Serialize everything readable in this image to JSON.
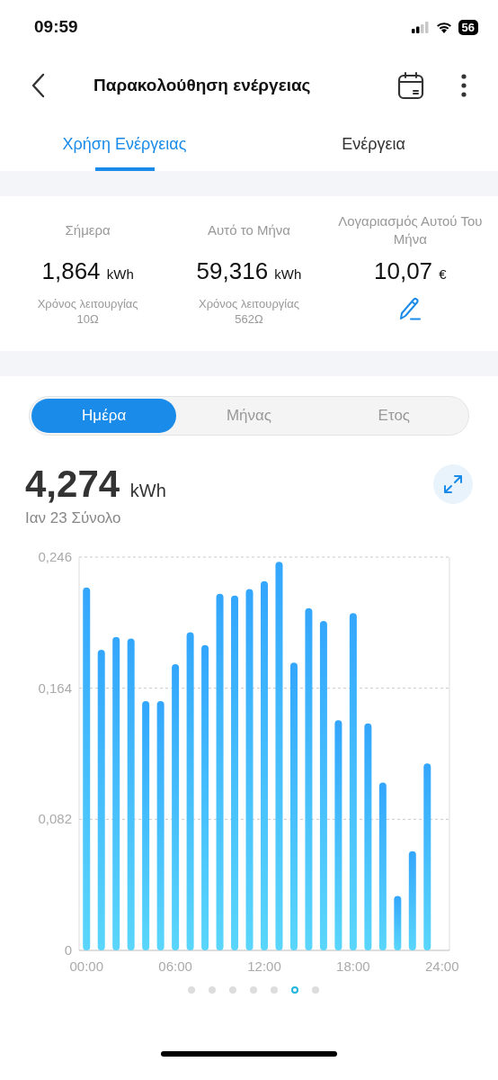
{
  "status_bar": {
    "time": "09:59",
    "battery": "56"
  },
  "header": {
    "title": "Παρακολούθηση ενέργειας"
  },
  "tabs": [
    {
      "label": "Χρήση Ενέργειας",
      "selected": true
    },
    {
      "label": "Ενέργεια",
      "selected": false
    }
  ],
  "stats": [
    {
      "label": "Σήμερα",
      "value": "1,864",
      "unit": "kWh",
      "note": "Χρόνος λειτουργίας",
      "note_value": "10Ω",
      "kind": "energy"
    },
    {
      "label": "Αυτό το Μήνα",
      "value": "59,316",
      "unit": "kWh",
      "note": "Χρόνος λειτουργίας",
      "note_value": "562Ω",
      "kind": "energy"
    },
    {
      "label": "Λογαριασμός Αυτού Του Μήνα",
      "value": "10,07",
      "unit": "€",
      "kind": "bill"
    }
  ],
  "periods": [
    {
      "label": "Ημέρα",
      "selected": true
    },
    {
      "label": "Μήνας",
      "selected": false
    },
    {
      "label": "Ετος",
      "selected": false
    }
  ],
  "total": {
    "value": "4,274",
    "unit": "kWh",
    "caption": "Ιαν 23 Σύνολο"
  },
  "chart_data": {
    "type": "bar",
    "x": [
      0,
      1,
      2,
      3,
      4,
      5,
      6,
      7,
      8,
      9,
      10,
      11,
      12,
      13,
      14,
      15,
      16,
      17,
      18,
      19,
      20,
      21,
      22,
      23
    ],
    "xlim": [
      -0.5,
      24.5
    ],
    "series": [
      {
        "color": "#33a6fd",
        "values": [
          0.227,
          0.188,
          0.196,
          0.195,
          0.156,
          0.156,
          0.179,
          0.199,
          0.191,
          0.223,
          0.222,
          0.226,
          0.231,
          0.243,
          0.18,
          0.214,
          0.206,
          0.144,
          0.211,
          0.142,
          0.105,
          0.034,
          0.062,
          0.117
        ]
      }
    ],
    "ylim": [
      0,
      0.246
    ],
    "yticks": [
      {
        "value": 0,
        "label": "0"
      },
      {
        "value": 0.082,
        "label": "0,082"
      },
      {
        "value": 0.164,
        "label": "0,164"
      },
      {
        "value": 0.246,
        "label": "0,246"
      }
    ],
    "xticks": [
      {
        "value": 0,
        "label": "00:00"
      },
      {
        "value": 6,
        "label": "06:00"
      },
      {
        "value": 12,
        "label": "12:00"
      },
      {
        "value": 18,
        "label": "18:00"
      },
      {
        "value": 24,
        "label": "24:00"
      }
    ]
  },
  "pager": [
    {
      "selected": false
    },
    {
      "selected": false
    },
    {
      "selected": false
    },
    {
      "selected": false
    },
    {
      "selected": false
    },
    {
      "selected": true
    },
    {
      "selected": false
    }
  ]
}
